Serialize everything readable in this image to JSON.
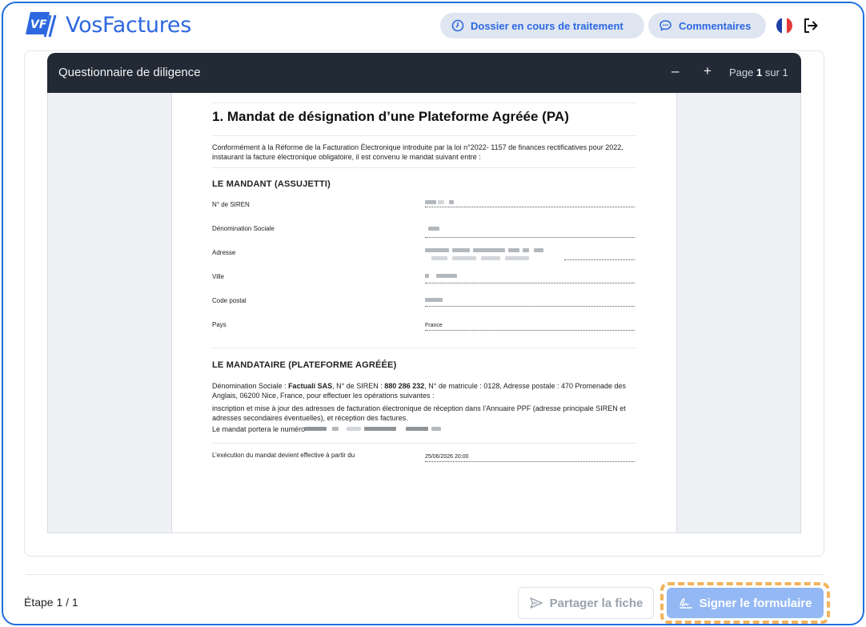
{
  "header": {
    "logo_text": "VosFactures",
    "status_label": "Dossier en cours de traitement",
    "comments_label": "Commentaires",
    "flag_colors": [
      "#1f3fa8",
      "#ffffff",
      "#e23a3a"
    ],
    "icons": [
      "clock-icon",
      "chat-icon",
      "france-flag-icon",
      "logout-icon"
    ]
  },
  "viewer": {
    "title": "Questionnaire de diligence",
    "zoom_out": "–",
    "zoom_in": "+",
    "page_prefix": "Page",
    "page_current": "1",
    "page_sep": "sur",
    "page_total": "1"
  },
  "document": {
    "title": "1. Mandat de désignation d’une Plateforme Agréée (PA)",
    "intro": "Conformément à la Réforme de la Facturation Électronique introduite par la loi n°2022- 1157 de finances rectificatives pour 2022, instaurant la facture électronique obligatoire, il est convenu le mandat suivant entre :",
    "mandant_heading": "LE MANDANT (ASSUJETTI)",
    "fields": [
      {
        "label": "N° de SIREN"
      },
      {
        "label": "Dénomination Sociale"
      },
      {
        "label": "Adresse"
      },
      {
        "label": "Ville"
      },
      {
        "label": "Code postal"
      },
      {
        "label": "Pays",
        "value": "France"
      }
    ],
    "mandataire_heading": "LE MANDATAIRE (PLATEFORME AGRÉÉE)",
    "mandataire_p1": {
      "prefix": "Dénomination Sociale : ",
      "company": "Factuali SAS",
      "siren_prefix": ", N° de SIREN : ",
      "siren": "880 286 232",
      "rest": ", N° de matricule : 0128, Adresse postale : 470 Promenade des Anglais, 06200 Nice, France, pour effectuer les opérations suivantes :"
    },
    "mandataire_p2": "inscription et mise à jour des adresses de facturation électronique de réception dans l’Annuaire PPF (adresse principale SIREN et adresses secondaires éventuelles), et réception des factures.",
    "mandat_number_label": "Le mandat portera le numéro",
    "effective_label": "L’exécution du mandat devient effective à partir du",
    "effective_value": "25/06/2026 20:00"
  },
  "footer": {
    "step": "Étape 1 / 1",
    "share_label": "Partager la fiche",
    "sign_label": "Signer le formulaire",
    "accent": "#2d68e0",
    "highlight": "#f3b35b"
  }
}
